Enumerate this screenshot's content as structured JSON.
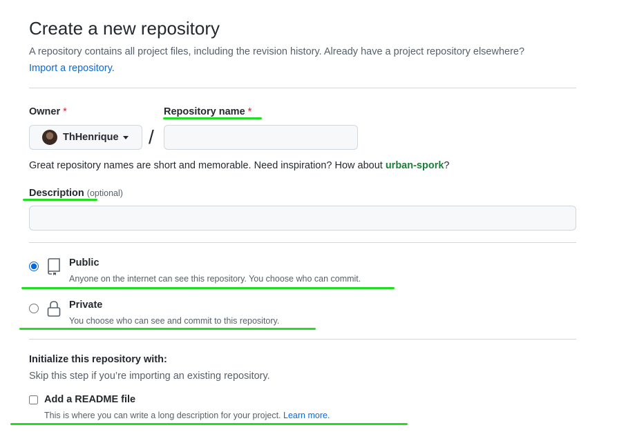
{
  "page": {
    "title": "Create a new repository",
    "subtitle": "A repository contains all project files, including the revision history. Already have a project repository elsewhere?",
    "import_link": "Import a repository."
  },
  "owner": {
    "label": "Owner",
    "required_mark": "*",
    "selected": "ThHenrique"
  },
  "repo_name": {
    "label": "Repository name",
    "required_mark": "*",
    "value": "",
    "separator": "/"
  },
  "name_hint": {
    "text": "Great repository names are short and memorable. Need inspiration? How about ",
    "suggestion": "urban-spork",
    "end": "?"
  },
  "description": {
    "label": "Description",
    "optional": "(optional)",
    "value": ""
  },
  "visibility": {
    "public": {
      "title": "Public",
      "desc": "Anyone on the internet can see this repository. You choose who can commit.",
      "selected": true,
      "icon": "repo-icon"
    },
    "private": {
      "title": "Private",
      "desc": "You choose who can see and commit to this repository.",
      "selected": false,
      "icon": "lock-icon"
    }
  },
  "init": {
    "heading": "Initialize this repository with:",
    "subtext": "Skip this step if you’re importing an existing repository.",
    "readme": {
      "label": "Add a README file",
      "desc": "This is where you can write a long description for your project.",
      "learn_more": "Learn more.",
      "checked": false
    }
  },
  "annotation_color": "#22dd22"
}
